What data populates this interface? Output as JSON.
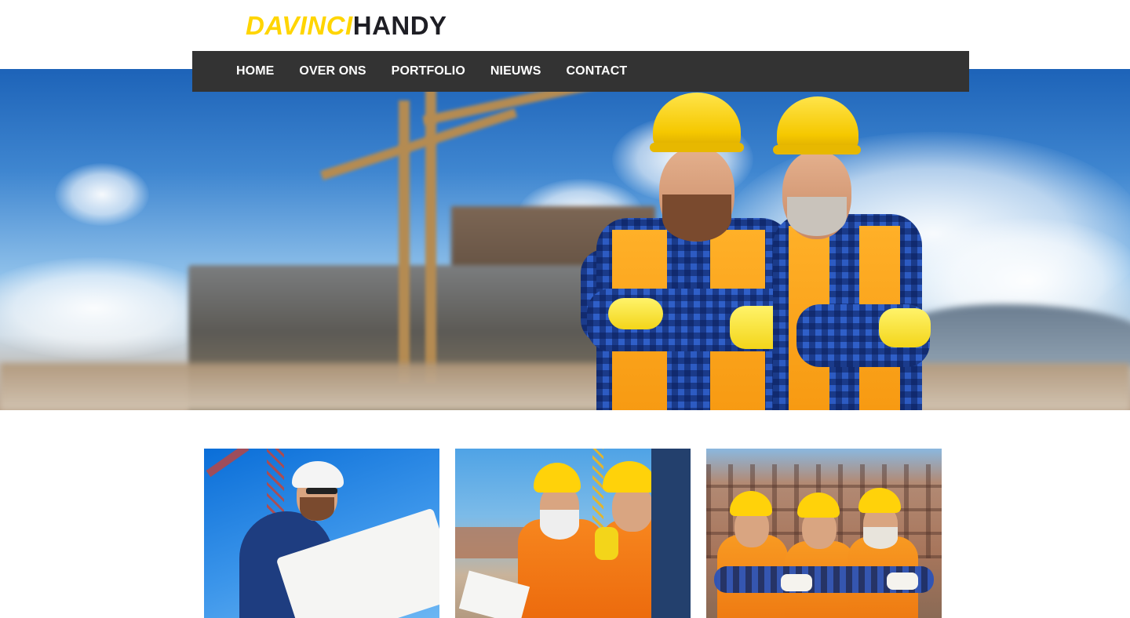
{
  "brand": {
    "logo_part1": "DAVINCI",
    "logo_part2": "HANDY",
    "accent_color": "#ffd500",
    "dark_color": "#1e1e24"
  },
  "nav": {
    "background_color": "#333333",
    "items": [
      {
        "label": "HOME"
      },
      {
        "label": "OVER ONS"
      },
      {
        "label": "PORTFOLIO"
      },
      {
        "label": "NIEUWS"
      },
      {
        "label": "CONTACT"
      }
    ]
  },
  "hero": {
    "image": "hero-construction-workers-image"
  },
  "gallery": {
    "items": [
      {
        "image": "engineer-reading-blueprint-image"
      },
      {
        "image": "workers-with-walkie-talkie-image"
      },
      {
        "image": "three-workers-at-site-image"
      }
    ]
  }
}
